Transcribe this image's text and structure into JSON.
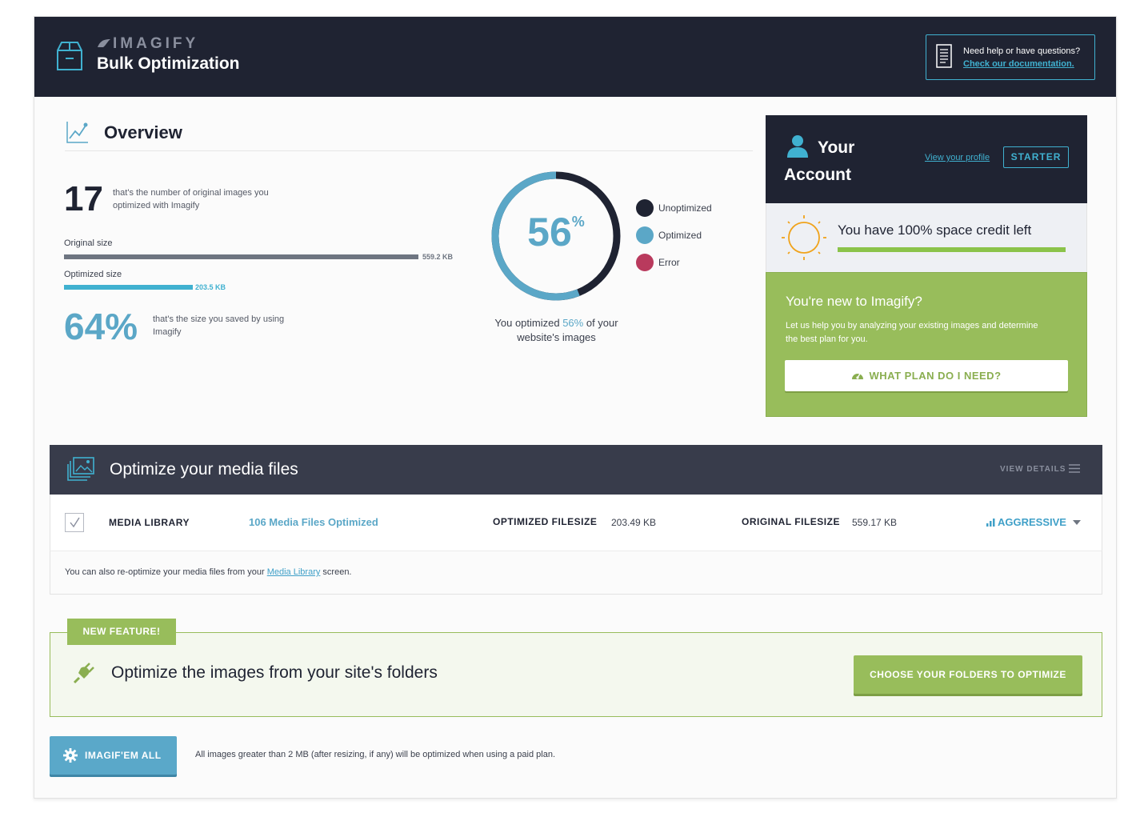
{
  "header": {
    "brand": "IMAGIFY",
    "title": "Bulk Optimization",
    "help_question": "Need help or have questions?",
    "help_link": "Check our documentation."
  },
  "overview": {
    "title": "Overview",
    "image_count": "17",
    "image_count_desc": "that's the number of original images you optimized with Imagify",
    "original_size_label": "Original size",
    "original_size_value": "559.2 KB",
    "optimized_size_label": "Optimized size",
    "optimized_size_value": "203.5 KB",
    "optimized_size_ratio": 0.364,
    "saved_percent": "64%",
    "saved_desc": "that's the size you saved by using Imagify",
    "donut_number": "56",
    "donut_suffix": "%",
    "donut_optimized_fraction": 0.56,
    "legend": [
      {
        "label": "Unoptimized",
        "color": "#1f2332"
      },
      {
        "label": "Optimized",
        "color": "#5ba7c7"
      },
      {
        "label": "Error",
        "color": "#b93a5d"
      }
    ],
    "caption_before": "You optimized ",
    "caption_highlight": "56%",
    "caption_after": " of your website's images"
  },
  "account": {
    "title_line1": "Your",
    "title_line2": "Account",
    "profile_link": "View your profile",
    "plan": "STARTER",
    "credit_text": "You have 100% space credit left",
    "credit_fraction": 1.0,
    "new_title": "You're new to Imagify?",
    "new_desc": "Let us help you by analyzing your existing images and determine the best plan for you.",
    "plan_button": "WHAT PLAN DO I NEED?"
  },
  "media": {
    "title": "Optimize your media files",
    "view_details": "VIEW DETAILS",
    "library_label": "MEDIA LIBRARY",
    "files_optimized": "106 Media Files Optimized",
    "optimized_filesize_label": "OPTIMIZED FILESIZE",
    "optimized_filesize_value": "203.49 KB",
    "original_filesize_label": "ORIGINAL FILESIZE",
    "original_filesize_value": "559.17 KB",
    "level": "AGGRESSIVE",
    "note_before": "You can also re-optimize your media files from your ",
    "note_link": "Media Library",
    "note_after": " screen."
  },
  "folders": {
    "badge": "NEW FEATURE!",
    "title": "Optimize the images from your site's folders",
    "button": "CHOOSE YOUR FOLDERS TO OPTIMIZE"
  },
  "footer": {
    "button": "IMAGIF'EM ALL",
    "note": "All images greater than 2 MB (after resizing, if any) will be optimized when using a paid plan."
  },
  "colors": {
    "dark": "#1f2332",
    "blue": "#5ba7c7",
    "cyan": "#40b1d0",
    "green": "#98bd5b",
    "error": "#b93a5d"
  }
}
